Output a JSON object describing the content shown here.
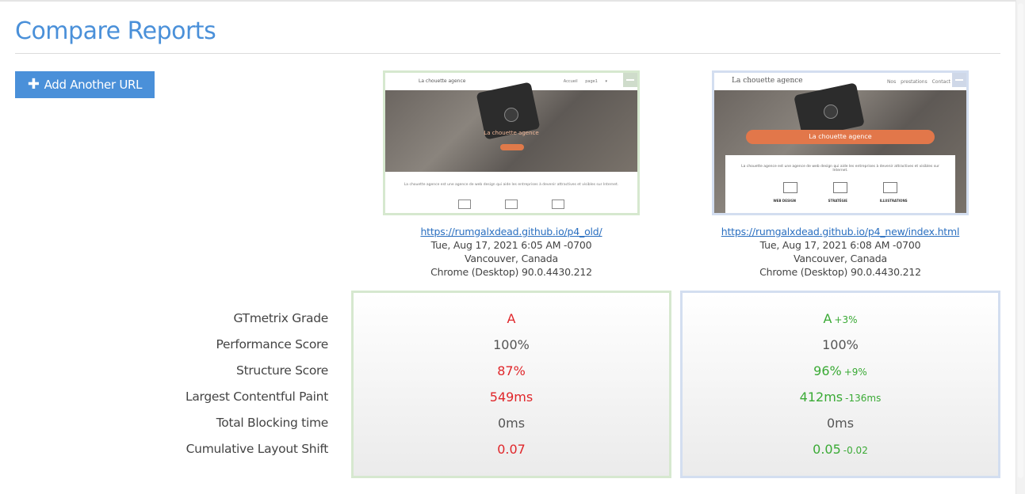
{
  "page": {
    "title": "Compare Reports"
  },
  "toolbar": {
    "add_url_label": "Add Another URL"
  },
  "reports": [
    {
      "url": "https://rumgalxdead.github.io/p4_old/",
      "date": "Tue, Aug 17, 2021 6:05 AM -0700",
      "location": "Vancouver, Canada",
      "browser": "Chrome (Desktop) 90.0.4430.212",
      "thumbnail": {
        "logo": "La chouette agence",
        "nav": "Accueil  page1 ▾",
        "hero_text": "La chouette agence",
        "body_text": "La chouette agence est une agence de web design qui aide les entreprises à devenir attractives et visibles sur Internet."
      },
      "metrics": {
        "grade": "A",
        "performance": "100%",
        "structure": "87%",
        "lcp": "549ms",
        "tbt": "0ms",
        "cls": "0.07"
      },
      "accent_color": "#d6e8cf"
    },
    {
      "url": "https://rumgalxdead.github.io/p4_new/index.html",
      "date": "Tue, Aug 17, 2021 6:08 AM -0700",
      "location": "Vancouver, Canada",
      "browser": "Chrome (Desktop) 90.0.4430.212",
      "thumbnail": {
        "logo": "La chouette agence",
        "nav": "Nos prestations  Contact",
        "hero_text": "La chouette agence",
        "body_text": "La chouette agence est une agence de web design qui aide les entreprises à devenir attractives et visibles sur Internet.",
        "services": [
          "WEB DESIGN",
          "STRATÉGIE",
          "ILLUSTRATIONS"
        ]
      },
      "metrics": {
        "grade": "A",
        "grade_delta": "+3%",
        "performance": "100%",
        "structure": "96%",
        "structure_delta": "+9%",
        "lcp": "412ms",
        "lcp_delta": "-136ms",
        "tbt": "0ms",
        "cls": "0.05",
        "cls_delta": "-0.02"
      },
      "accent_color": "#d3def0"
    }
  ],
  "metric_labels": {
    "grade": "GTmetrix Grade",
    "performance": "Performance Score",
    "structure": "Structure Score",
    "lcp": "Largest Contentful Paint",
    "tbt": "Total Blocking time",
    "cls": "Cumulative Layout Shift"
  },
  "colors": {
    "title": "#4a90d9",
    "button": "#4a90d9",
    "worse": "#e0262a",
    "better": "#3aaa35",
    "link": "#2a6fc0"
  }
}
